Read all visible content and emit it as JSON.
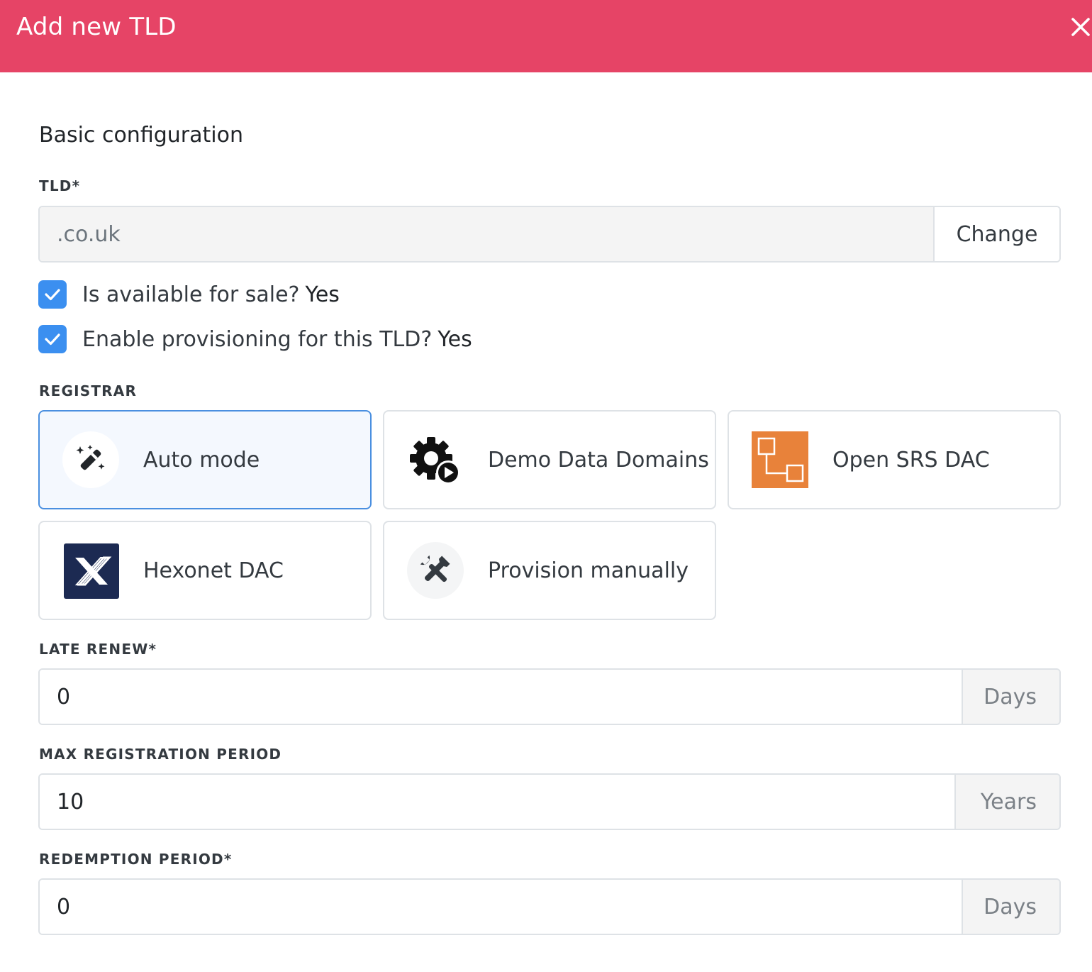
{
  "header": {
    "title": "Add new TLD"
  },
  "basic": {
    "section_title": "Basic configuration",
    "tld_label": "TLD*",
    "tld_value": ".co.uk",
    "change_label": "Change"
  },
  "checks": [
    {
      "label": "Is available for sale?",
      "value": "Yes",
      "checked": true
    },
    {
      "label": "Enable provisioning for this TLD?",
      "value": "Yes",
      "checked": true
    }
  ],
  "registrar": {
    "label": "REGISTRAR",
    "options": [
      {
        "label": "Auto mode",
        "icon": "magic-wand-icon",
        "selected": true
      },
      {
        "label": "Demo Data Domains",
        "icon": "gear-play-icon",
        "selected": false
      },
      {
        "label": "Open SRS DAC",
        "icon": "opensrs-logo",
        "selected": false
      },
      {
        "label": "Hexonet DAC",
        "icon": "hexonet-logo",
        "selected": false
      },
      {
        "label": "Provision manually",
        "icon": "tools-icon",
        "selected": false
      }
    ]
  },
  "late_renew": {
    "label": "LATE RENEW*",
    "value": "0",
    "unit": "Days"
  },
  "max_registration": {
    "label": "MAX REGISTRATION PERIOD",
    "value": "10",
    "unit": "Years"
  },
  "redemption": {
    "label": "REDEMPTION PERIOD*",
    "value": "0",
    "unit": "Days"
  },
  "colors": {
    "header": "#e64466",
    "checkbox": "#3b8ff0",
    "selected_border": "#4a8fe0",
    "opensrs": "#e8823a",
    "hexonet": "#1c2a52"
  }
}
